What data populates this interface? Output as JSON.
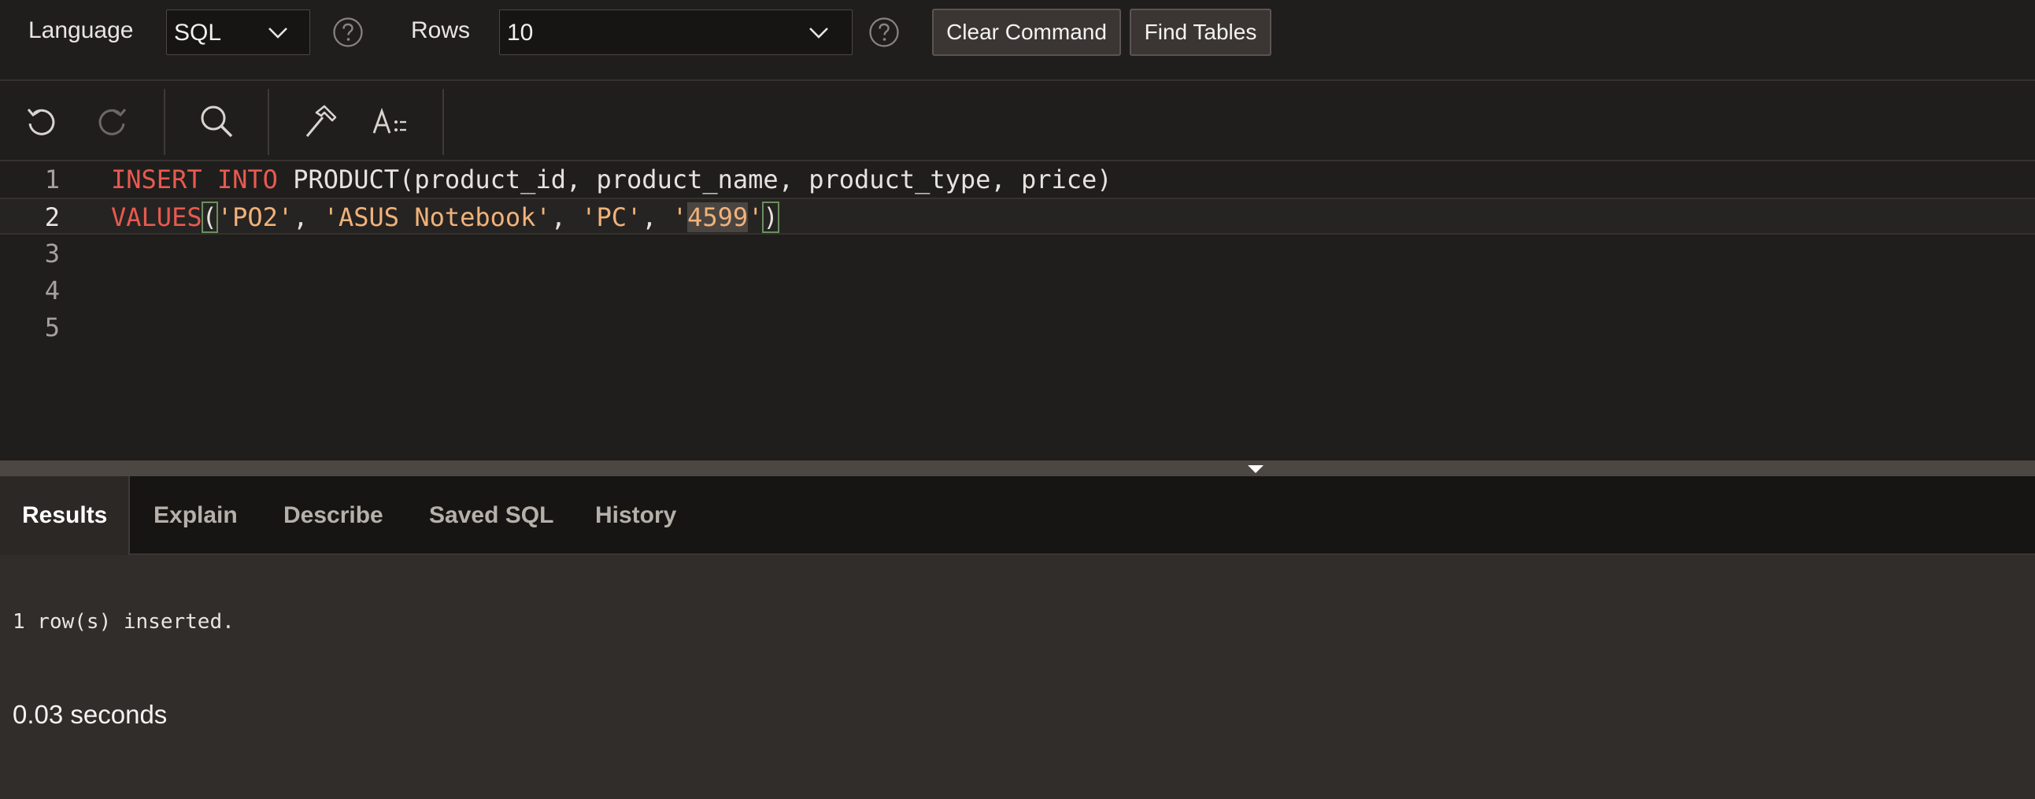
{
  "toolbar": {
    "language_label": "Language",
    "language_value": "SQL",
    "rows_label": "Rows",
    "rows_value": "10",
    "clear_command_label": "Clear Command",
    "find_tables_label": "Find Tables"
  },
  "editor_toolbar": {
    "icons": [
      "undo-icon",
      "redo-icon",
      "search-icon",
      "hammer-icon",
      "format-icon"
    ]
  },
  "editor": {
    "line_numbers": [
      "1",
      "2",
      "3",
      "4",
      "5"
    ],
    "line1": {
      "kw1": "INSERT",
      "kw2": "INTO",
      "rest": "PRODUCT(product_id, product_name, product_type, price)"
    },
    "line2": {
      "kw": "VALUES",
      "open_paren": "(",
      "s1": "'PO2'",
      "sep1": ", ",
      "s2": "'ASUS Notebook'",
      "sep2": ", ",
      "s3": "'PC'",
      "sep3": ", ",
      "q_open": "'",
      "num": "4599",
      "q_close": "'",
      "close_paren": ")"
    }
  },
  "tabs": [
    {
      "label": "Results",
      "active": true
    },
    {
      "label": "Explain"
    },
    {
      "label": "Describe"
    },
    {
      "label": "Saved SQL"
    },
    {
      "label": "History"
    }
  ],
  "results": {
    "message": "1 row(s) inserted.",
    "elapsed": "0.03 seconds"
  },
  "colors": {
    "keyword": "#e85a50",
    "string": "#f0b27a",
    "background": "#201e1c"
  }
}
